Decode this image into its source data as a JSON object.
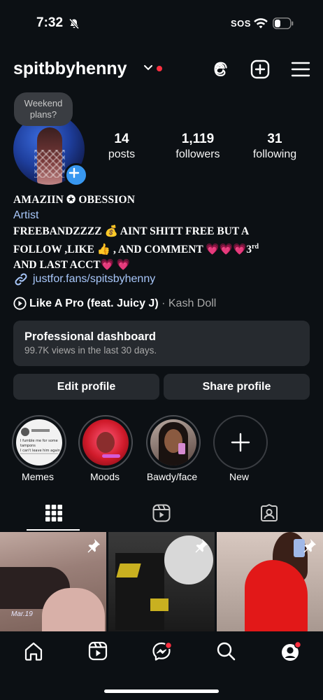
{
  "status_bar": {
    "time": "7:32",
    "sos": "SOS"
  },
  "header": {
    "username": "spitbbyhenny"
  },
  "note": {
    "text": "Weekend plans?"
  },
  "stats": [
    {
      "count": "14",
      "label": "posts"
    },
    {
      "count": "1,119",
      "label": "followers"
    },
    {
      "count": "31",
      "label": "following"
    }
  ],
  "bio": {
    "name": "AMAZIIN ✪ OBESSION",
    "category": "Artist",
    "line1": "FREEBANDZZZZ 💰 AINT SHITT FREE BUT A",
    "line2": "FOLLOW ,LIKE 👍 , AND COMMENT 💗💗💗3",
    "line2_sup": "rd",
    "line3": "AND LAST ACCT💗 💗",
    "link": "justfor.fans/spitsbyhenny",
    "music_title": "Like A Pro (feat. Juicy J)",
    "music_artist": " · Kash Doll"
  },
  "dashboard": {
    "title": "Professional dashboard",
    "subtitle": "99.7K views in the last 30 days."
  },
  "buttons": {
    "edit": "Edit profile",
    "share": "Share profile"
  },
  "highlights": [
    {
      "label": "Memes"
    },
    {
      "label": "Moods"
    },
    {
      "label": "Bawdy/face"
    },
    {
      "label": "New"
    }
  ],
  "memes_thumb": {
    "line1": "I fumble me for some tampons",
    "line2": "I can't leave him again"
  },
  "grid_caption": "Mar.19",
  "colors": {
    "background": "#0c1014",
    "surface": "#262a2f",
    "link": "#a8c7fa",
    "accent_blue": "#3897f0",
    "notification_red": "#ff3040"
  },
  "icons": [
    "threads-icon",
    "create-icon",
    "menu-icon",
    "grid-icon",
    "reels-icon",
    "tagged-icon",
    "home-icon",
    "messenger-icon",
    "search-icon",
    "profile-icon",
    "pin-icon"
  ]
}
